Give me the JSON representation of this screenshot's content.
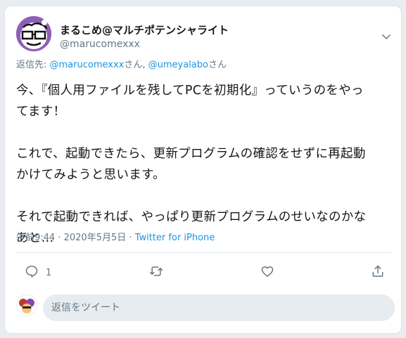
{
  "tweet": {
    "author": {
      "display_name": "まるこめ@マルチポテンシャライト",
      "handle": "@marucomexxx"
    },
    "reply_to": {
      "prefix": "返信先: ",
      "users": [
        "@marucomexxx",
        "@umeyalabo"
      ],
      "suffix": "さん",
      "separator": ", "
    },
    "text": {
      "p1_l1": "今、『個人用ファイルを残してPCを初期化』っていうのをやっ",
      "p1_l2": "てます！",
      "p2_l1": "これで、起動できたら、更新プログラムの確認をせずに再起動",
      "p2_l2": "かけてみようと思います。",
      "p3_l1": "それで起動できれば、やっぱり更新プログラムのせいなのかな",
      "p3_l2": "あと…"
    },
    "meta": {
      "time": "午前9:44",
      "dot": " · ",
      "date": "2020年5月5日",
      "source": "Twitter for iPhone"
    },
    "actions": {
      "reply_count": "1"
    },
    "reply_box": {
      "placeholder": "返信をツイート"
    }
  },
  "colors": {
    "accent": "#1b95e0",
    "secondary_text": "#657786",
    "icon": "#657786",
    "avatar_bg": "#8e5fb6"
  },
  "icons": [
    "chevron-down-icon",
    "reply-icon",
    "retweet-icon",
    "like-icon",
    "share-icon"
  ]
}
